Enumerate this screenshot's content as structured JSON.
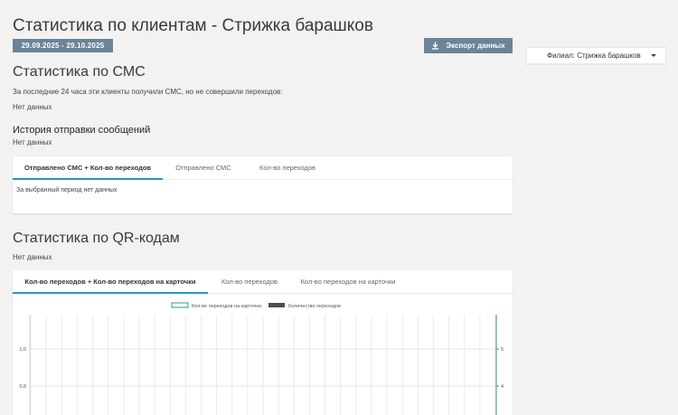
{
  "page": {
    "title": "Статистика по клиентам - Стрижка барашков",
    "date_range": "29.09.2025 - 29.10.2025",
    "export_label": "Экспорт данных",
    "branch_label": "Филиал: Стрижка барашков"
  },
  "sms": {
    "heading": "Статистика по СМС",
    "description": "За последние 24 часа эти клиенты получили СМС, но не совершили переходов:",
    "no_data": "Нет данных",
    "history_heading": "История отправки сообщений",
    "history_no_data": "Нет данных",
    "tabs": [
      "Отправлено СМС + Кол-во переходов",
      "Отправлено СМС",
      "Кол-во переходов"
    ],
    "period_no_data": "За выбранный период нет данных"
  },
  "qr": {
    "heading": "Статистика по QR-кодам",
    "no_data": "Нет данных",
    "tabs": [
      "Кол-во переходов + Кол-во переходов на карточки",
      "Кол-во переходов",
      "Кол-во переходов на карточки"
    ]
  },
  "chart_data": {
    "type": "bar",
    "series": [
      {
        "name": "Кол-во переходов на карточки",
        "color": "#2e9c7a",
        "values": []
      },
      {
        "name": "Количество переходов",
        "color": "#4a4f55",
        "values": []
      }
    ],
    "y_left_ticks": [
      "1.0",
      "0.8"
    ],
    "y_right_ticks": [
      "5",
      "4"
    ],
    "legend_position": "top-center",
    "grid": true
  },
  "icons": {
    "export": "download-icon",
    "branch": "chevron-down-icon"
  }
}
